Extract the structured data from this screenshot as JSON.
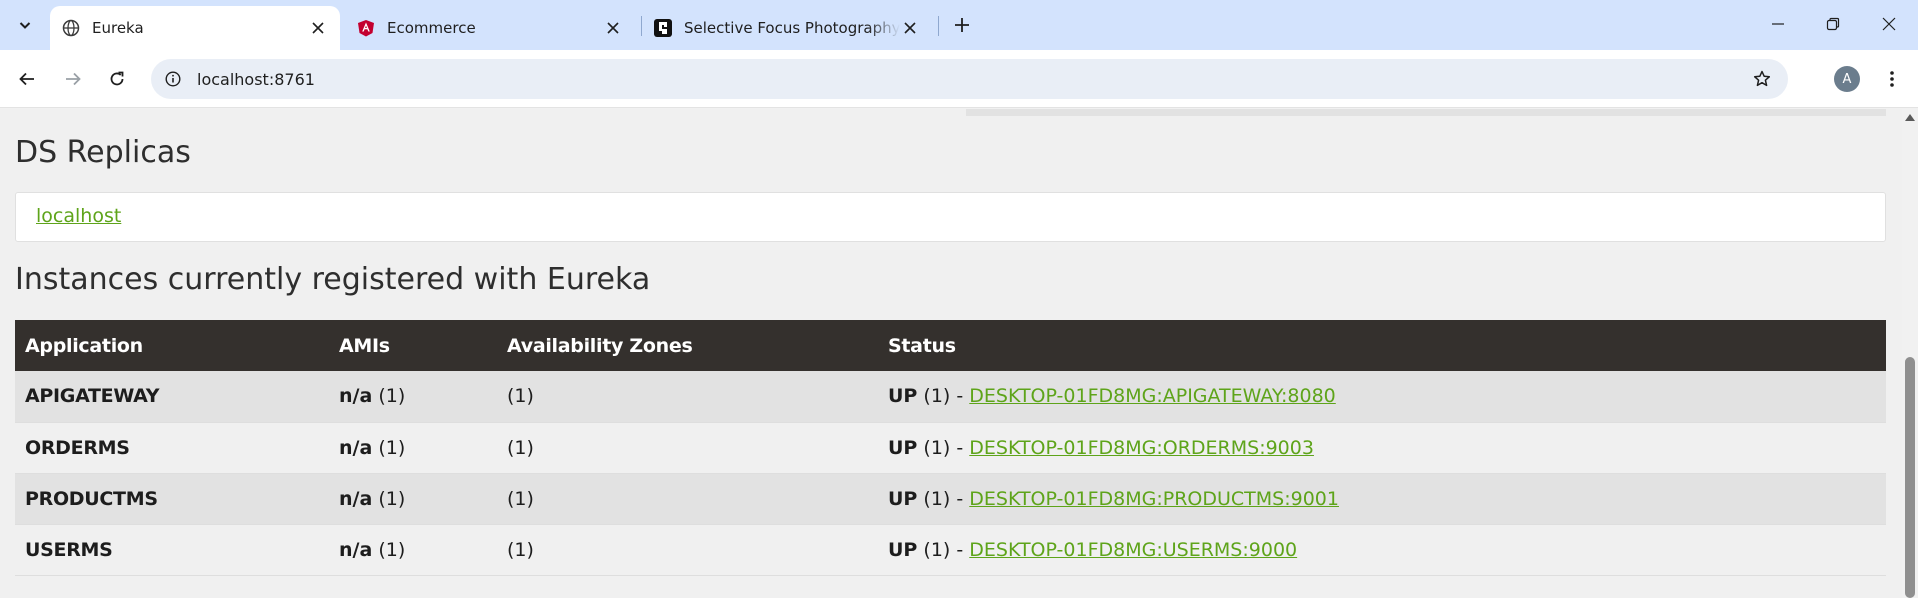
{
  "browser": {
    "tabs": [
      {
        "title": "Eureka",
        "icon": "globe-icon",
        "active": true
      },
      {
        "title": "Ecommerce",
        "icon": "angular-icon",
        "active": false
      },
      {
        "title": "Selective Focus Photography of",
        "icon": "unsplash-icon",
        "active": false
      }
    ],
    "url": "localhost:8761",
    "avatar_letter": "A",
    "colors": {
      "tabstrip": "#d3e3fd",
      "active_tab": "#ffffff",
      "omnibox": "#e9eef6"
    }
  },
  "page": {
    "replicas_heading": "DS Replicas",
    "replica_link": "localhost",
    "instances_heading": "Instances currently registered with Eureka",
    "table": {
      "headers": [
        "Application",
        "AMIs",
        "Availability Zones",
        "Status"
      ],
      "rows": [
        {
          "application": "APIGATEWAY",
          "ami_label": "n/a",
          "ami_count": "(1)",
          "zones": "(1)",
          "status_label": "UP",
          "status_count": "(1) -",
          "instance_link": "DESKTOP-01FD8MG:APIGATEWAY:8080"
        },
        {
          "application": "ORDERMS",
          "ami_label": "n/a",
          "ami_count": "(1)",
          "zones": "(1)",
          "status_label": "UP",
          "status_count": "(1) -",
          "instance_link": "DESKTOP-01FD8MG:ORDERMS:9003"
        },
        {
          "application": "PRODUCTMS",
          "ami_label": "n/a",
          "ami_count": "(1)",
          "zones": "(1)",
          "status_label": "UP",
          "status_count": "(1) -",
          "instance_link": "DESKTOP-01FD8MG:PRODUCTMS:9001"
        },
        {
          "application": "USERMS",
          "ami_label": "n/a",
          "ami_count": "(1)",
          "zones": "(1)",
          "status_label": "UP",
          "status_count": "(1) -",
          "instance_link": "DESKTOP-01FD8MG:USERMS:9000"
        }
      ]
    },
    "colors": {
      "link": "#5ea41a",
      "table_header": "#34302d",
      "row_odd": "#e2e2e2",
      "row_even": "#f0f0f0"
    }
  }
}
